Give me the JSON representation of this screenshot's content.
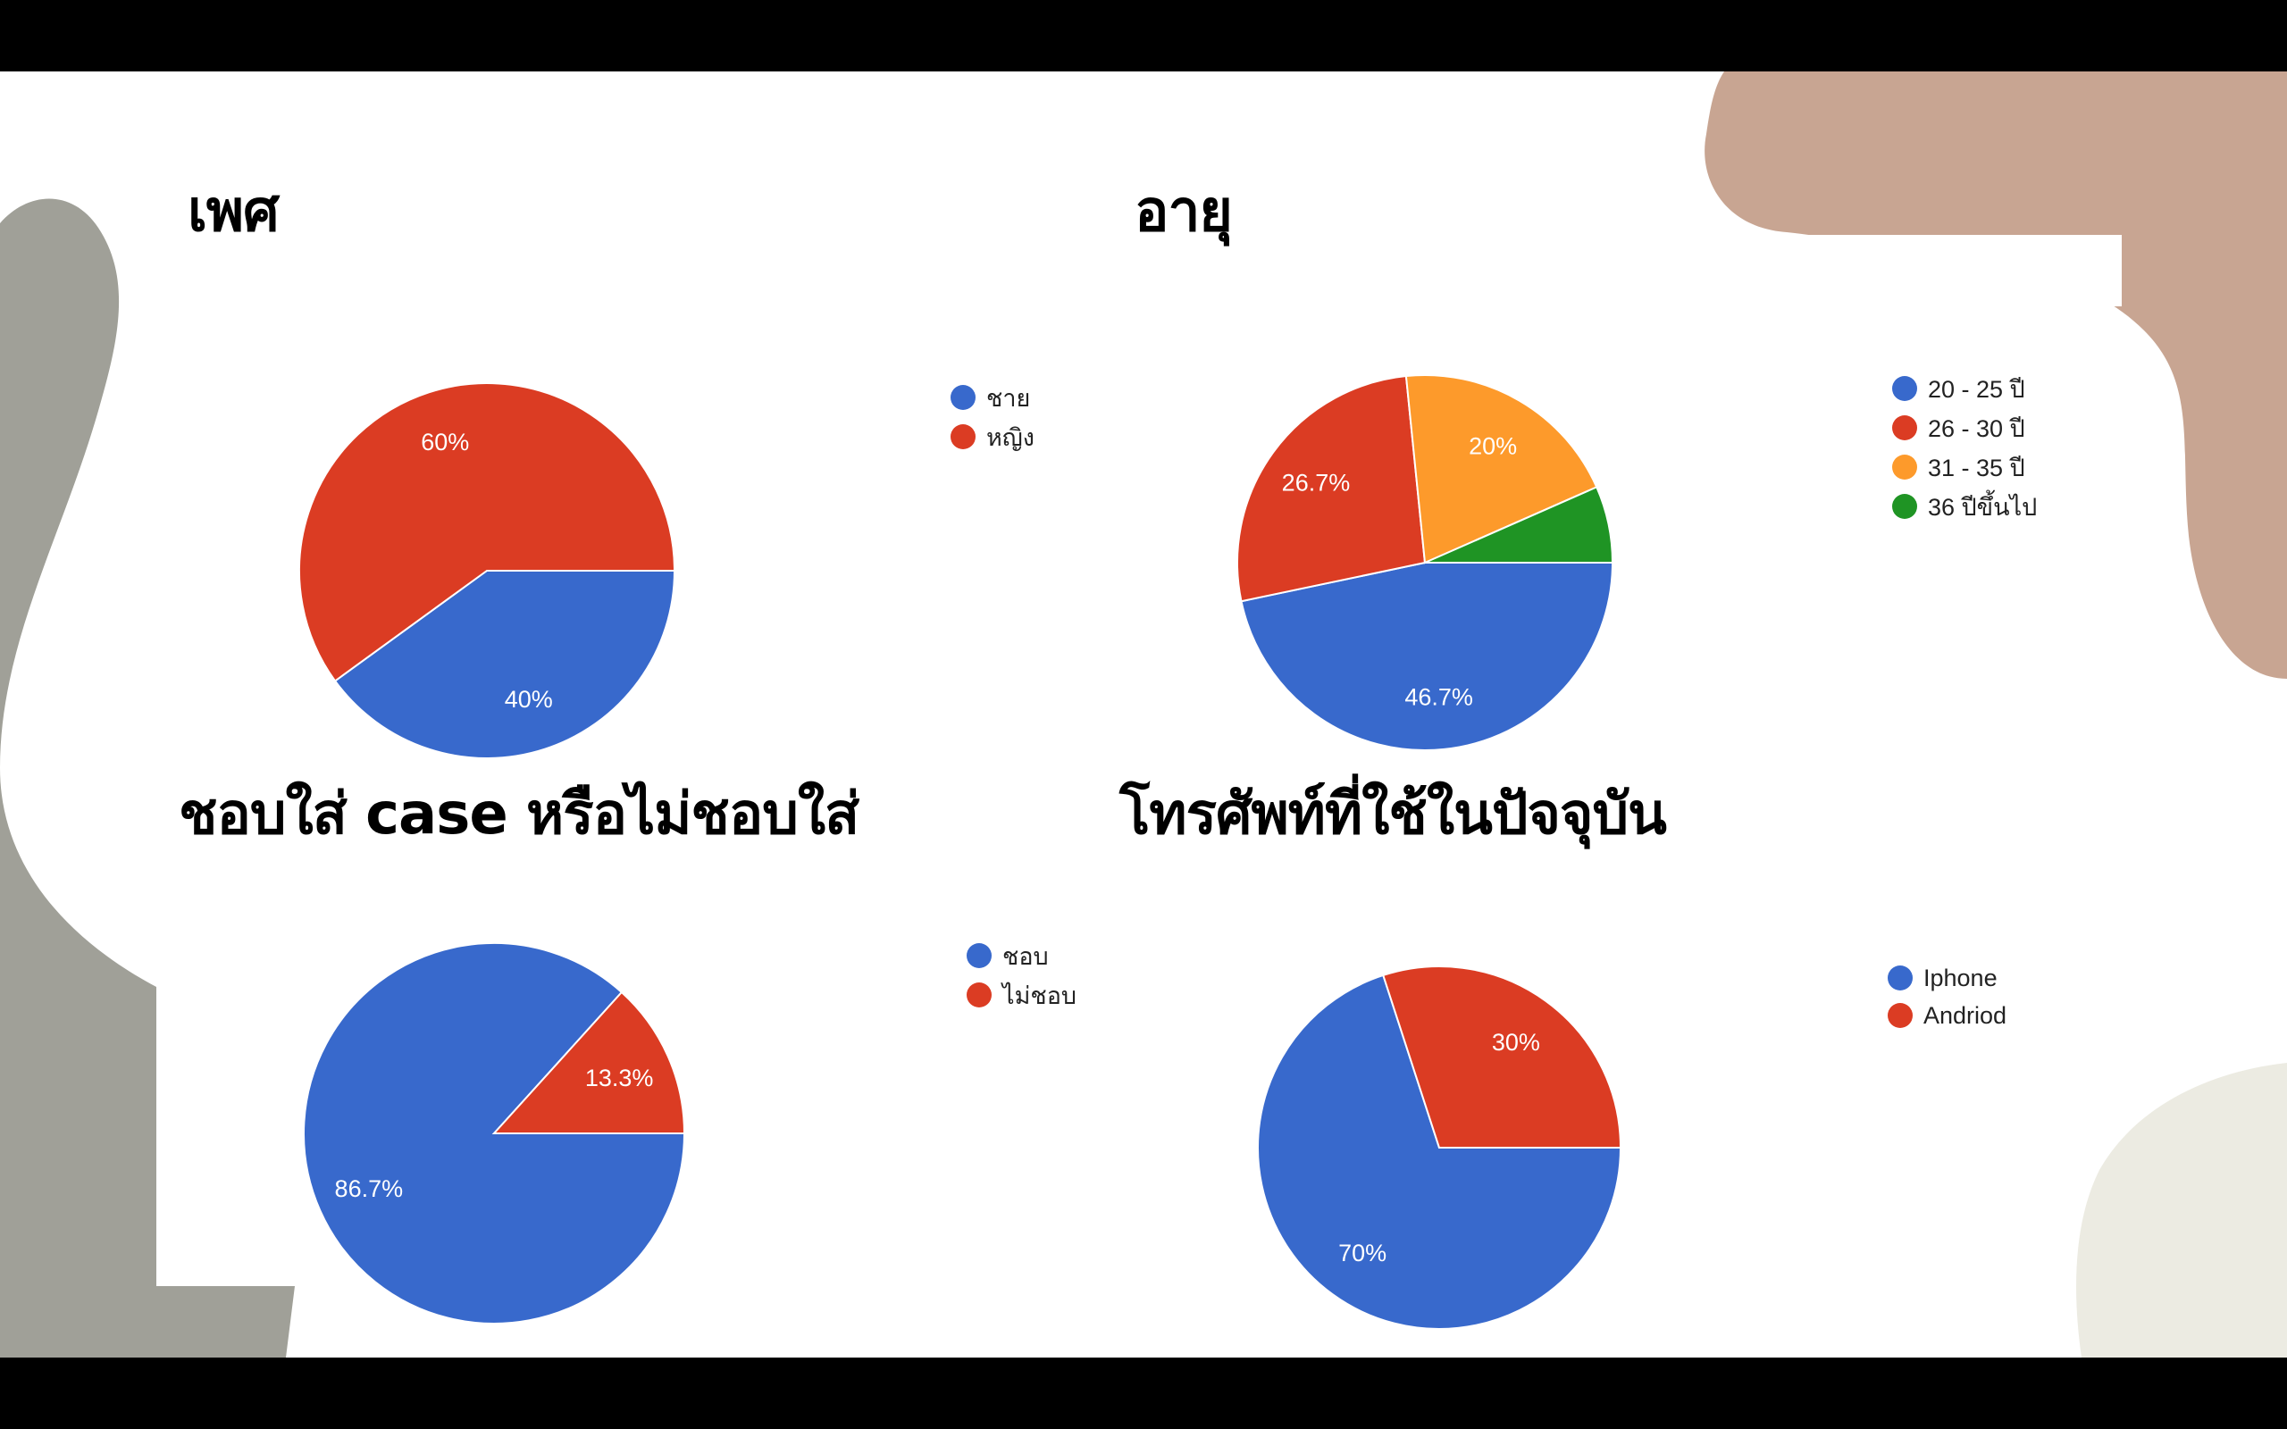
{
  "colors": {
    "blue": "#3869cc",
    "red": "#db3c23",
    "orange": "#fd9a2b",
    "green": "#1f9424",
    "blob_gray": "#a0a098",
    "blob_tan": "#c8a592",
    "blob_cream": "#ecebe2"
  },
  "chart_data": [
    {
      "type": "pie",
      "title": "เพศ",
      "legend_position": "right",
      "categories": [
        "ชาย",
        "หญิง"
      ],
      "values": [
        40,
        60
      ],
      "labels": [
        "40%",
        "60%"
      ],
      "colors": [
        "#3869cc",
        "#db3c23"
      ]
    },
    {
      "type": "pie",
      "title": "อายุ",
      "legend_position": "right",
      "categories": [
        "20 - 25 ปี",
        "26 - 30 ปี",
        "31 - 35 ปี",
        "36 ปีขึ้นไป"
      ],
      "values": [
        46.7,
        26.7,
        20,
        6.6
      ],
      "labels": [
        "46.7%",
        "26.7%",
        "20%",
        ""
      ],
      "colors": [
        "#3869cc",
        "#db3c23",
        "#fd9a2b",
        "#1f9424"
      ]
    },
    {
      "type": "pie",
      "title": "ชอบใส่ case หรือไม่ชอบใส่",
      "legend_position": "right",
      "categories": [
        "ชอบ",
        "ไม่ชอบ"
      ],
      "values": [
        86.7,
        13.3
      ],
      "labels": [
        "86.7%",
        "13.3%"
      ],
      "colors": [
        "#3869cc",
        "#db3c23"
      ]
    },
    {
      "type": "pie",
      "title": "โทรศัพท์ที่ใช้ในปัจจุบัน",
      "legend_position": "right",
      "categories": [
        "Iphone",
        "Andriod"
      ],
      "values": [
        70,
        30
      ],
      "labels": [
        "70%",
        "30%"
      ],
      "colors": [
        "#3869cc",
        "#db3c23"
      ]
    }
  ]
}
